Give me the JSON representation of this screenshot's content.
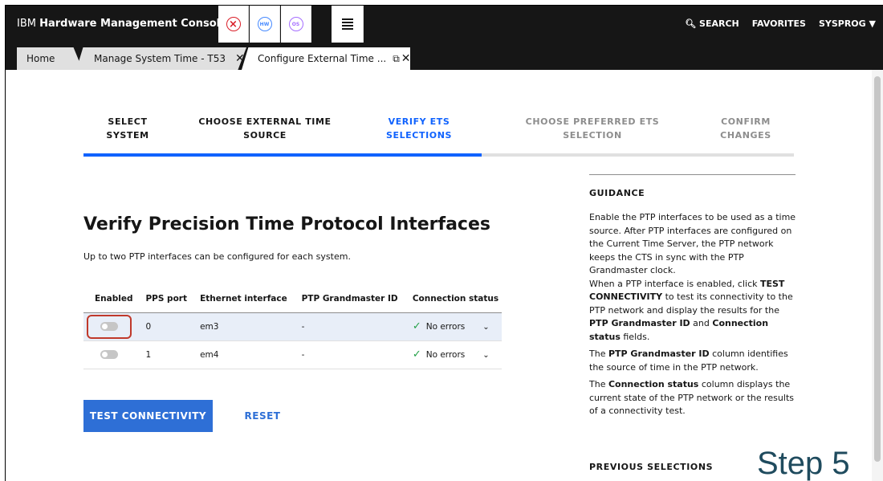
{
  "header": {
    "brand_prefix": "IBM",
    "brand_name": "Hardware Management Console",
    "icons": [
      "error-circle-icon",
      "hw-circle-icon",
      "os-circle-icon",
      "task-list-icon"
    ],
    "hw_label": "HW",
    "os_label": "OS",
    "search": "SEARCH",
    "favorites": "FAVORITES",
    "user": "SYSPROG"
  },
  "tabs": [
    {
      "label": "Home"
    },
    {
      "label": "Manage System Time - T53"
    },
    {
      "label": "Configure External Time ..."
    }
  ],
  "stepper": {
    "steps": [
      {
        "line1": "SELECT",
        "line2": "SYSTEM",
        "state": "done"
      },
      {
        "line1": "CHOOSE EXTERNAL TIME",
        "line2": "SOURCE",
        "state": "done"
      },
      {
        "line1": "VERIFY ETS",
        "line2": "SELECTIONS",
        "state": "current"
      },
      {
        "line1": "CHOOSE PREFERRED ETS",
        "line2": "SELECTION",
        "state": "todo"
      },
      {
        "line1": "CONFIRM",
        "line2": "CHANGES",
        "state": "todo"
      }
    ],
    "progress": 0.56
  },
  "main": {
    "title": "Verify Precision Time Protocol Interfaces",
    "subtitle": "Up to two PTP interfaces can be configured for each system.",
    "table": {
      "columns": [
        "Enabled",
        "PPS port",
        "Ethernet interface",
        "PTP Grandmaster ID",
        "Connection status"
      ],
      "rows": [
        {
          "enabled": false,
          "pps": "0",
          "eth": "em3",
          "gm": "-",
          "status": "No errors"
        },
        {
          "enabled": false,
          "pps": "1",
          "eth": "em4",
          "gm": "-",
          "status": "No errors"
        }
      ]
    },
    "test_button": "TEST CONNECTIVITY",
    "reset_button": "RESET"
  },
  "guidance": {
    "heading": "GUIDANCE",
    "p1a": "Enable the PTP interfaces to be used as a time source. After PTP interfaces are configured on the Current Time Server, the PTP network keeps the CTS in sync with the PTP Grandmaster clock.",
    "p1b_1": "When a PTP interface is enabled, click ",
    "p1b_b1": "TEST CONNECTIVITY",
    "p1b_2": " to test its connectivity to the PTP network and display the results for the ",
    "p1b_b2": "PTP Grandmaster ID",
    "p1b_3": " and ",
    "p1b_b3": "Connection status",
    "p1b_4": " fields.",
    "p2_1": "The ",
    "p2_b": "PTP Grandmaster ID",
    "p2_2": " column identifies the source of time in the PTP network.",
    "p3_1": "The ",
    "p3_b": "Connection status",
    "p3_2": " column displays the current state of the PTP network or the results of a connectivity test.",
    "previous": "PREVIOUS SELECTIONS"
  },
  "overlay_label": "Step 5"
}
